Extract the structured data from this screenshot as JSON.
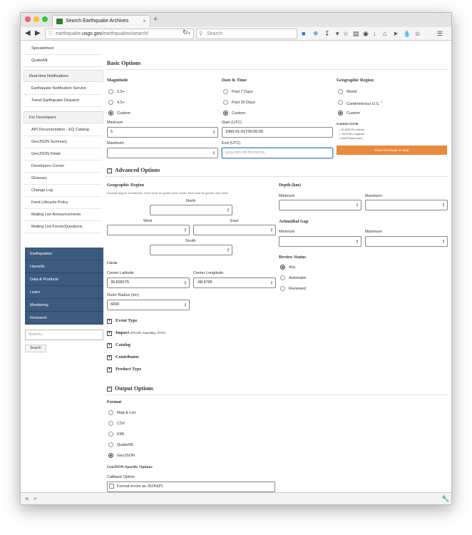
{
  "browser": {
    "tab_title": "Search Earthquake Archives",
    "tab_close": "×",
    "new_tab": "+",
    "url_host": "earthquake.usgs.gov",
    "url_prefix": "earthquake.",
    "url_domain": "usgs.gov",
    "url_path": "/earthquakes/search/",
    "search_placeholder": "Search",
    "icons": [
      "back-icon",
      "forward-icon",
      "info-icon",
      "reload-icon",
      "search-icon",
      "bookmark-star-icon",
      "reading-list-icon",
      "pocket-icon",
      "download-icon",
      "home-icon",
      "send-icon",
      "dropper-icon",
      "emoji-icon",
      "menu-icon"
    ]
  },
  "sidebar": {
    "top_items": [
      "Spreadsheet",
      "QuakeML"
    ],
    "realtime_header": "Real-time Notifications",
    "realtime_items": [
      "Earthquake Notification Service",
      "Tweet Earthquake Dispatch"
    ],
    "dev_header": "For Developers",
    "dev_items": [
      "API Documentation - EQ Catalog",
      "GeoJSON Summary",
      "GeoJSON Detail",
      "Developers Corner",
      "Glossary",
      "Change Log",
      "Feed Lifecycle Policy",
      "Mailing List-Announcements",
      "Mailing List-Forum/Questions"
    ],
    "nav_items": [
      "Earthquakes",
      "Hazards",
      "Data & Products",
      "Learn",
      "Monitoring",
      "Research"
    ],
    "search_placeholder": "Search...",
    "search_button": "Search",
    "nav_color": "#3c5b7e"
  },
  "basic": {
    "title": "Basic Options",
    "magnitude": {
      "title": "Magnitude",
      "options": [
        "2.5+",
        "4.5+",
        "Custom"
      ],
      "selected": "Custom",
      "min_label": "Minimum",
      "min_value": "5",
      "max_label": "Maximum",
      "max_value": ""
    },
    "datetime": {
      "title": "Date & Time",
      "options": [
        "Past 7 Days",
        "Past 30 Days",
        "Custom"
      ],
      "selected": "Custom",
      "start_label": "Start (UTC)",
      "start_value": "1960-01-01T00:00:00",
      "end_label": "End (UTC)",
      "end_placeholder": "yyyy-mm-dd hh:mm:ss"
    },
    "geo": {
      "title": "Geographic Region",
      "options": [
        "World",
        "Conterminous U.S.",
        "Custom"
      ],
      "conterminous_sup": "1",
      "selected": "Custom",
      "circle_label": "Custom Circle",
      "circle_lines": [
        "39.828175 Latitude",
        "-98.5795 Longitude",
        "6000 Radius (km)"
      ],
      "draw_button": "Draw Rectangle on Map",
      "draw_color": "#e98a3c"
    }
  },
  "advanced": {
    "title": "Advanced Options",
    "toggle": "−",
    "geo_title": "Geographic Region",
    "geo_note": "Decimal degree coordinates. North must be greater than South. East must be greater than West.",
    "north": "North",
    "west": "West",
    "east": "East",
    "south": "South",
    "circle_title": "Circle",
    "center_lat_label": "Center Latitude",
    "center_lat": "39.828175",
    "center_lon_label": "Center Longitude",
    "center_lon": "-98.5795",
    "radius_label": "Outer Radius (km)",
    "radius": "6000",
    "depth_title": "Depth (km)",
    "depth_min": "Minimum",
    "depth_max": "Maximum",
    "gap_title": "Azimuthal Gap",
    "gap_min": "Minimum",
    "gap_max": "Maximum",
    "review_title": "Review Status",
    "review_options": [
      "Any",
      "Automatic",
      "Reviewed"
    ],
    "review_selected": "Any",
    "collapsibles": [
      "Event Type",
      "Impact",
      "Catalog",
      "Contributor",
      "Product Type"
    ],
    "impact_sub": "(PAGER, ShakeMap, DYFI)",
    "plus": "+"
  },
  "output": {
    "title": "Output Options",
    "toggle": "−",
    "format_title": "Format",
    "formats": [
      "Map & List",
      "CSV",
      "KML",
      "QuakeML",
      "GeoJSON"
    ],
    "selected": "GeoJSON",
    "geojson_title": "GeoJSON-Specific Options",
    "callback_label": "Callback Option",
    "callback_value": "",
    "format_errors": "Format errors as JSON(P)"
  },
  "bottom": {
    "close": "×",
    "expand": "»",
    "wrench": "wrench-icon"
  }
}
